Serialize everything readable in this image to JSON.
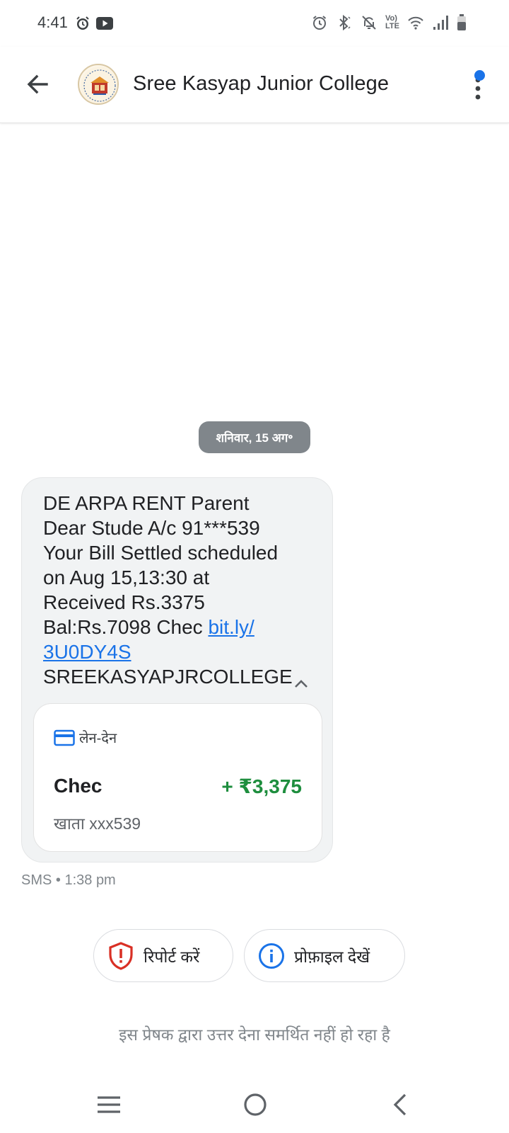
{
  "status_bar": {
    "time": "4:41",
    "left_icons": [
      "alarm-icon",
      "youtube-icon"
    ],
    "right_icons": [
      "alarm-icon",
      "bluetooth-icon",
      "mute-icon",
      "volte-icon",
      "wifi-icon",
      "signal-icon",
      "battery-icon"
    ],
    "volte_label_top": "Vo)",
    "volte_label_bottom": "LTE"
  },
  "app_bar": {
    "title": "Sree Kasyap Junior College",
    "back_icon": "arrow-back-icon",
    "more_icon": "more-vert-icon",
    "notification_dot_color": "#1a73e8"
  },
  "conversation": {
    "date_chip": "शनिवार, 15 अग॰",
    "message": {
      "lines": [
        "DE ARPA RENT Parent",
        "Dear Stude A/c 91***539",
        "Your Bill Settled scheduled",
        "on Aug 15,13:30 at",
        "Received Rs.3375",
        "Bal:Rs.7098 Chec "
      ],
      "link_part1": "bit.ly/",
      "link_part2": "3U0DY4S",
      "sender_line": "SREEKASYAPJRCOLLEGE",
      "transaction_card": {
        "header": "लेन-देन",
        "name": "Chec",
        "amount": "+ ₹3,375",
        "amount_color": "#1e8e3e",
        "account": "खाता xxx539"
      },
      "meta": "SMS • 1:38 pm"
    }
  },
  "actions": {
    "report_label": "रिपोर्ट करें",
    "report_color": "#d93025",
    "profile_label": "प्रोफ़ाइल देखें",
    "profile_color": "#1a73e8"
  },
  "reply_notice": "इस प्रेषक द्वारा उत्तर देना समर्थित नहीं हो रहा है",
  "nav_bar": {
    "buttons": [
      "recent-apps-icon",
      "home-icon",
      "back-icon"
    ]
  }
}
